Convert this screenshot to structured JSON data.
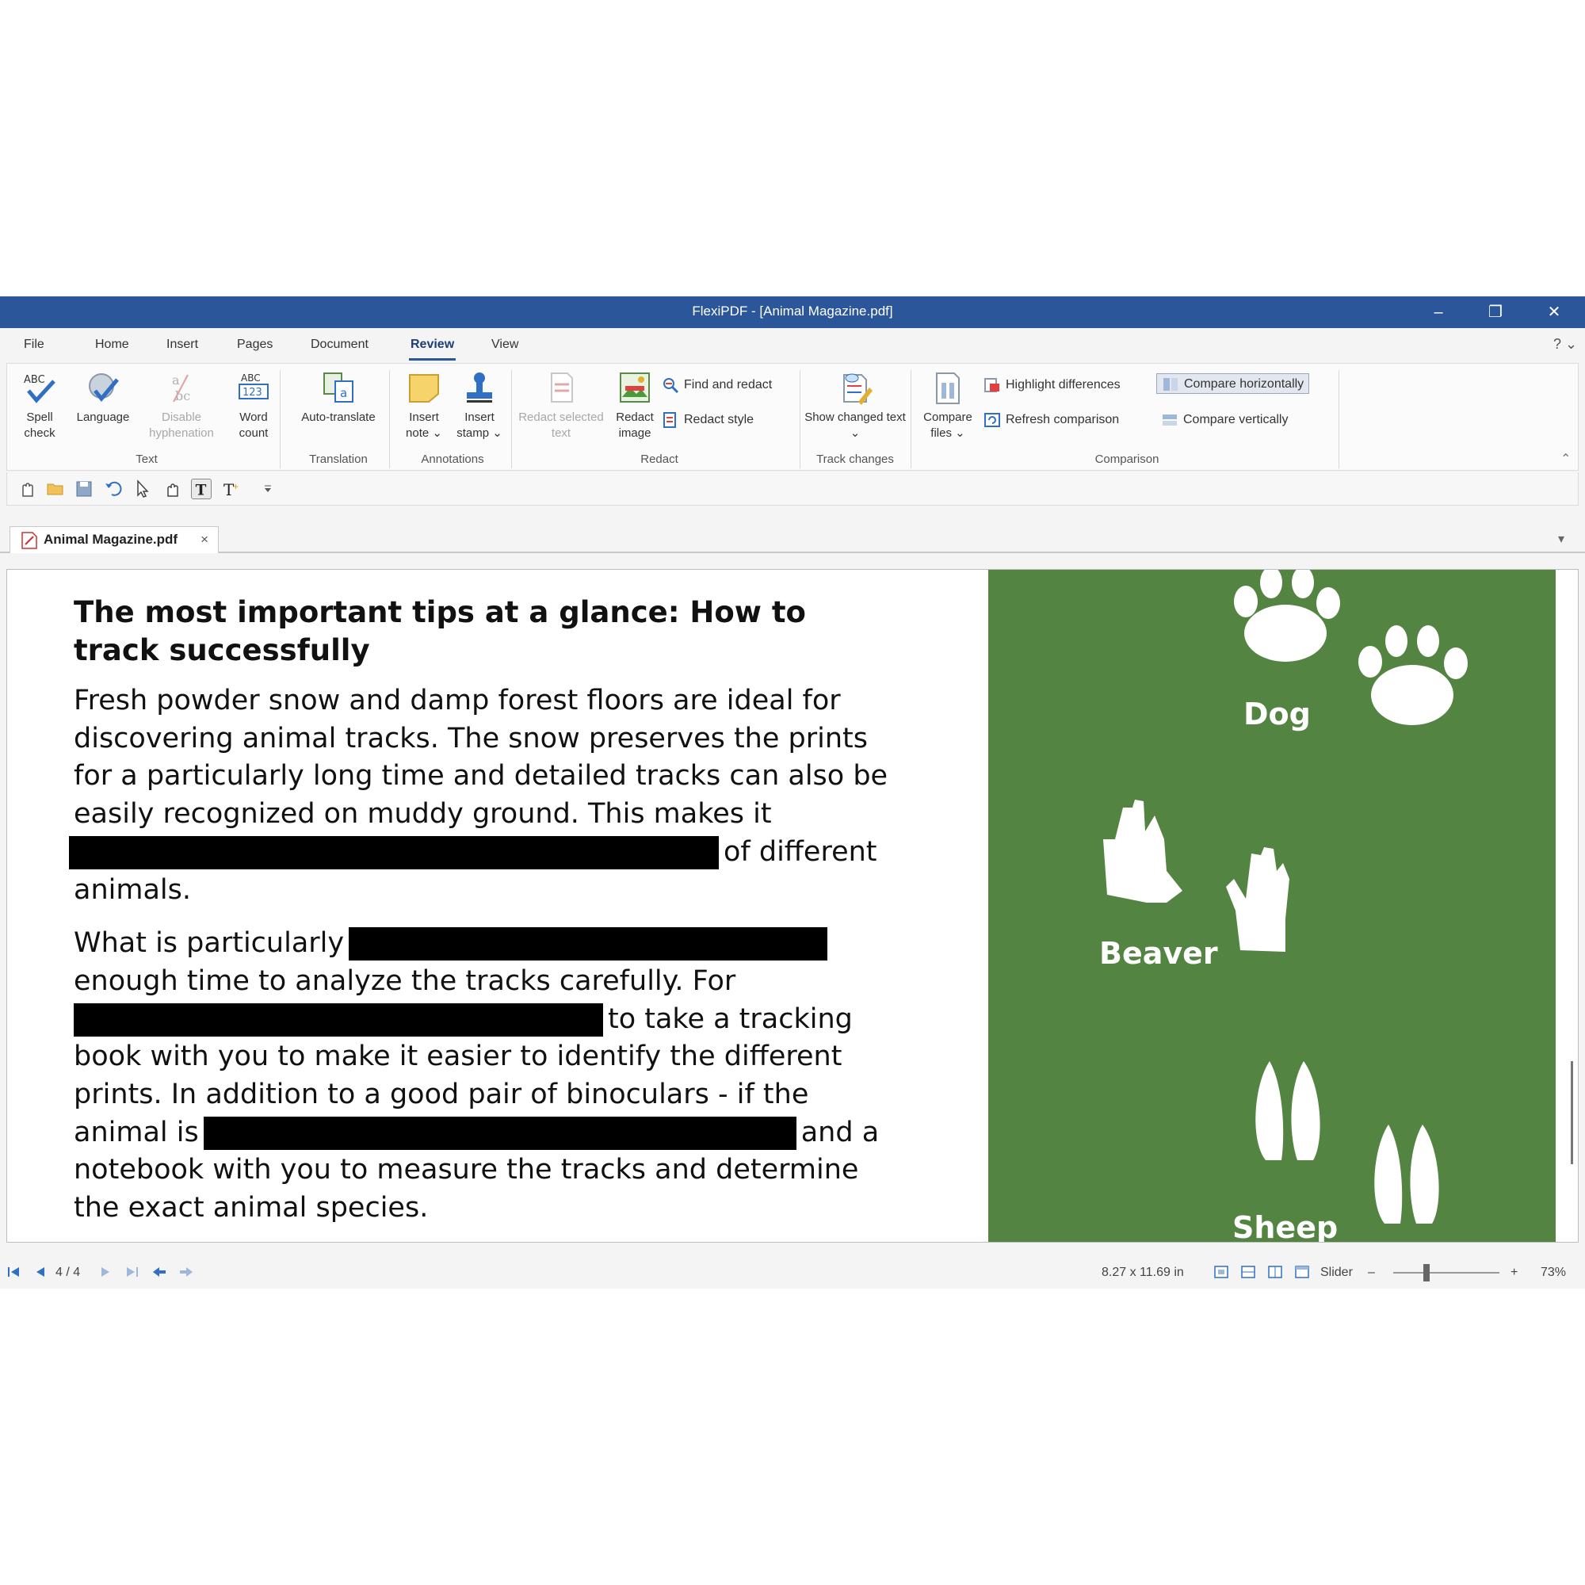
{
  "window": {
    "title": "FlexiPDF - [Animal Magazine.pdf]",
    "minimize": "–",
    "restore": "❐",
    "close": "✕"
  },
  "menu": {
    "items": [
      "File",
      "Home",
      "Insert",
      "Pages",
      "Document",
      "Review",
      "View"
    ],
    "active": "Review",
    "help": "? ⌄"
  },
  "ribbon": {
    "text_group": {
      "label": "Text",
      "spell_check": "Spell check",
      "language": "Language",
      "disable_hyphenation": "Disable hyphenation",
      "word_count": "Word count"
    },
    "translation_group": {
      "label": "Translation",
      "auto_translate": "Auto-translate"
    },
    "annotations_group": {
      "label": "Annotations",
      "insert_note": "Insert note ⌄",
      "insert_stamp": "Insert stamp ⌄"
    },
    "redact_group": {
      "label": "Redact",
      "redact_selected_text": "Redact selected text",
      "redact_image": "Redact image",
      "find_and_redact": "Find and redact",
      "redact_style": "Redact style"
    },
    "track_changes_group": {
      "label": "Track changes",
      "show_changed_text": "Show changed text ⌄"
    },
    "comparison_group": {
      "label": "Comparison",
      "compare_files": "Compare files ⌄",
      "highlight_differences": "Highlight differences",
      "refresh_comparison": "Refresh comparison",
      "compare_horizontally": "Compare horizontally",
      "compare_vertically": "Compare vertically"
    },
    "collapse": "⌃"
  },
  "doc_tab": {
    "name": "Animal Magazine.pdf",
    "close": "×",
    "overflow": "▾"
  },
  "document": {
    "heading": "The most important tips at a glance: How to track successfully",
    "para1_visible": "Fresh powder snow and damp forest floors are ideal for discovering animal tracks. The snow preserves the prints for a particularly long time and detailed tracks can also be easily recognized on muddy ground. This makes it",
    "para1_after_redact": "of different animals.",
    "para2_start": "What is particularly",
    "para2_mid1": "enough time to analyze the tracks carefully. For",
    "para2_mid2": "to take a tracking book with you to make it easier to identify the different prints. In addition to a good pair of binoculars - if the animal is",
    "para2_end": "and a notebook with you to measure the tracks and determine the exact animal species.",
    "animals": [
      "Dog",
      "Beaver",
      "Sheep"
    ],
    "panel_color": "#548441"
  },
  "statusbar": {
    "page": "4 / 4",
    "page_size": "8.27 x 11.69 in",
    "zoom_mode": "Slider",
    "zoom_minus": "–",
    "zoom_plus": "+",
    "zoom": "73%"
  },
  "colors": {
    "titlebar": "#2b579a",
    "accent": "#2b579a"
  }
}
